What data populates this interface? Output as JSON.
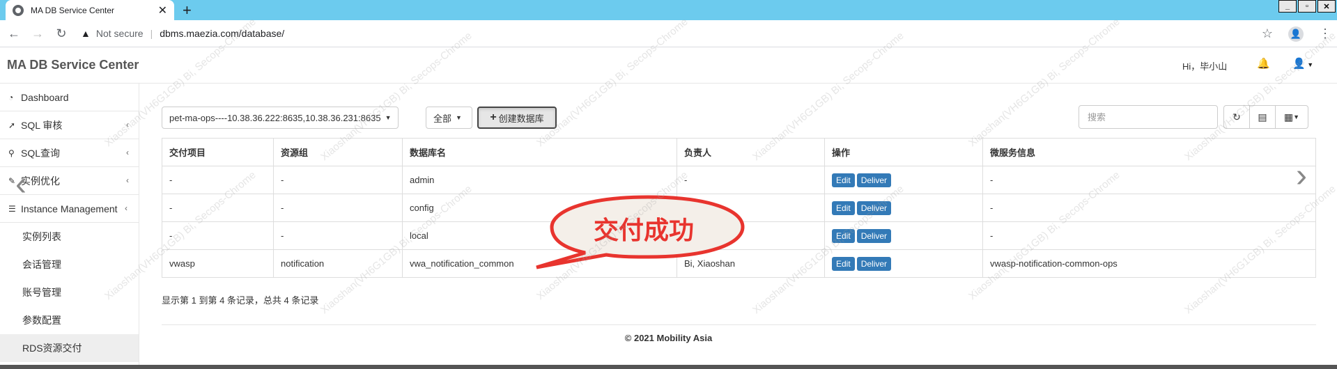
{
  "browser": {
    "tab_title": "MA DB Service Center",
    "new_tab": "+",
    "security_label": "Not secure",
    "url": "dbms.maezia.com/database/"
  },
  "header": {
    "brand": "MA DB Service Center",
    "greeting": "Hi，毕小山"
  },
  "sidebar": {
    "items": [
      {
        "label": "Dashboard",
        "icon": "tachometer-icon"
      },
      {
        "label": "SQL 审核",
        "icon": "rocket-icon"
      },
      {
        "label": "SQL查询",
        "icon": "search-icon"
      },
      {
        "label": "实例优化",
        "icon": "wrench-icon"
      },
      {
        "label": "Instance Management",
        "icon": "database-icon"
      }
    ],
    "subitems": [
      "实例列表",
      "会话管理",
      "账号管理",
      "参数配置",
      "RDS资源交付"
    ]
  },
  "toolbar": {
    "instance_select": "pet-ma-ops----10.38.36.222:8635,10.38.36.231:8635",
    "filter_select": "全部",
    "create_button": "创建数据库",
    "search_placeholder": "搜索"
  },
  "table": {
    "columns": [
      "交付项目",
      "资源组",
      "数据库名",
      "负责人",
      "操作",
      "微服务信息"
    ],
    "rows": [
      {
        "project": "-",
        "group": "-",
        "db": "admin",
        "owner": "-",
        "micro": "-"
      },
      {
        "project": "-",
        "group": "-",
        "db": "config",
        "owner": "-",
        "micro": "-"
      },
      {
        "project": "-",
        "group": "-",
        "db": "local",
        "owner": "-",
        "micro": "-"
      },
      {
        "project": "vwasp",
        "group": "notification",
        "db": "vwa_notification_common",
        "owner": "Bi, Xiaoshan",
        "micro": "vwasp-notification-common-ops"
      }
    ],
    "edit_label": "Edit",
    "deliver_label": "Deliver"
  },
  "summary": "显示第 1 到第 4 条记录，总共 4 条记录",
  "footer": "© 2021 Mobility Asia",
  "callout": "交付成功",
  "watermark": {
    "line1": "Xiaoshan(VH6G1GB)",
    "line2": "Bi, Secops-Chrome"
  },
  "colors": {
    "tabstrip": "#6ccbee",
    "button_primary": "#337ab7",
    "callout_fill": "#f4efe9",
    "callout_stroke": "#e8342e"
  }
}
